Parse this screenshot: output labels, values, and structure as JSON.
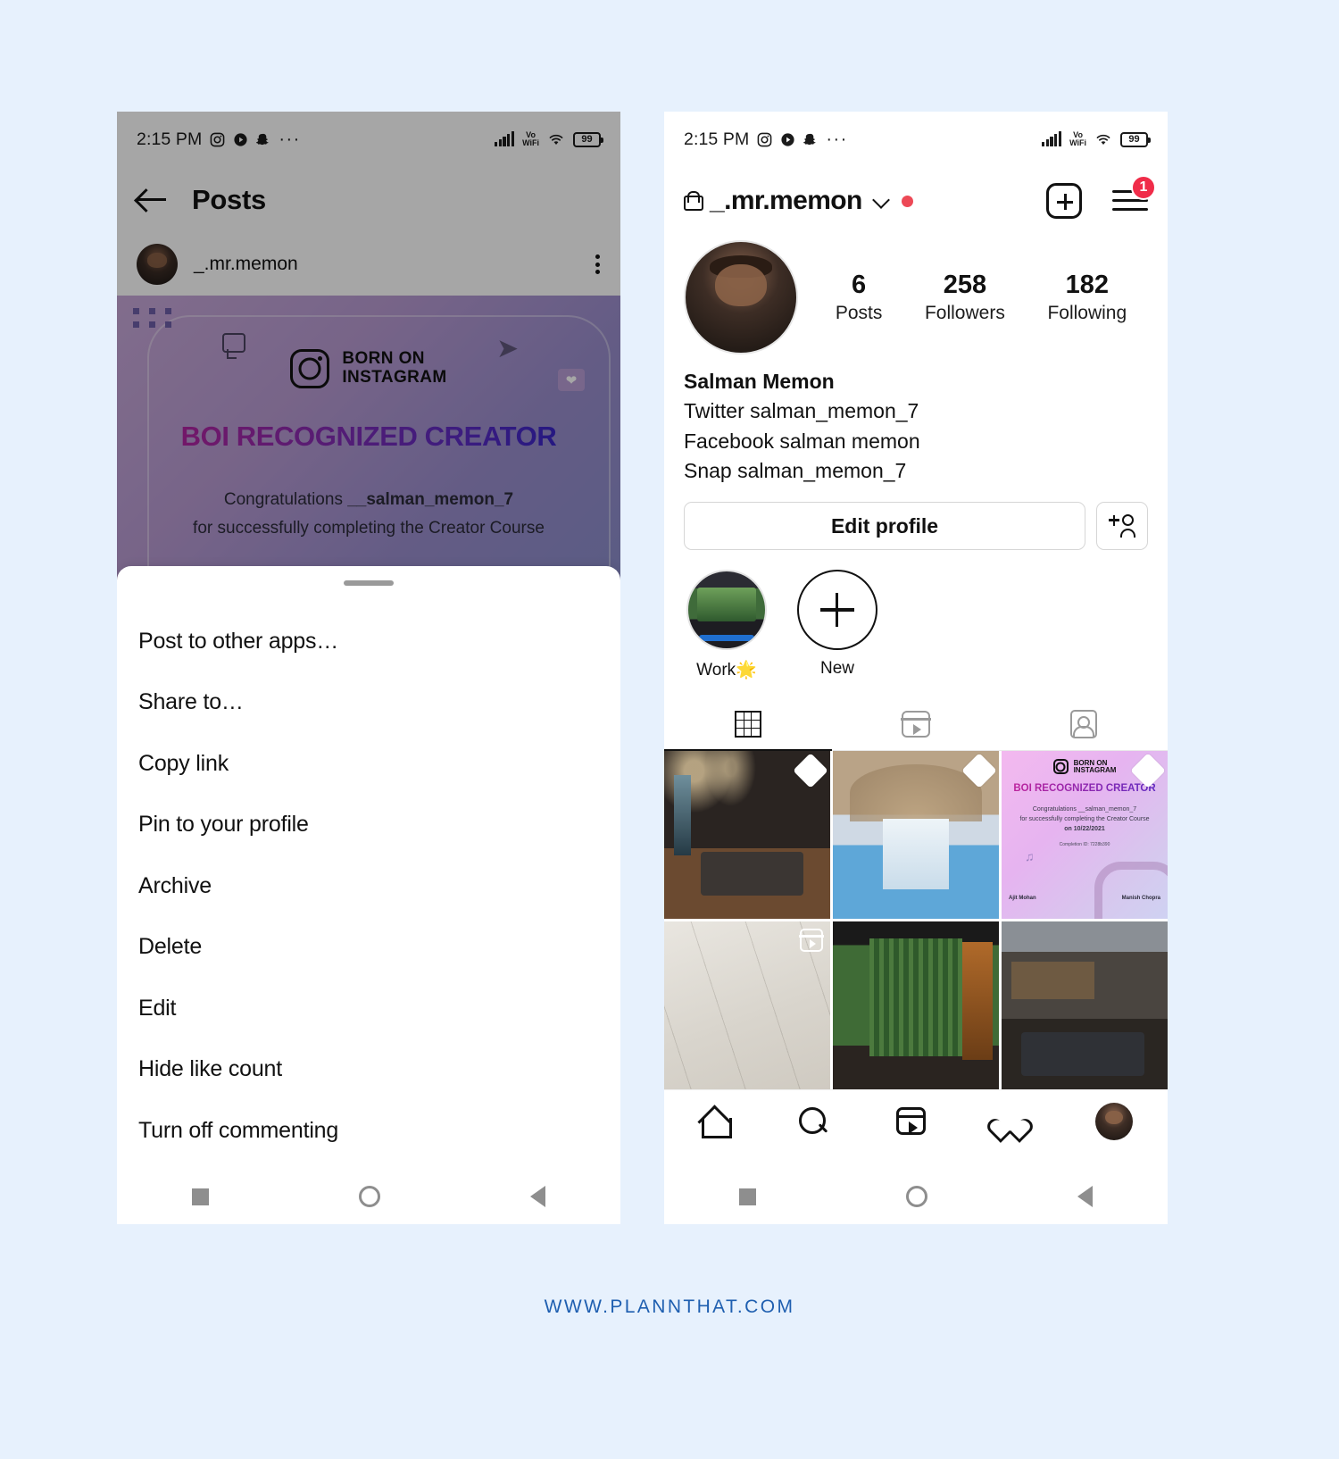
{
  "page": {
    "background_color": "#e7f1fd",
    "footer_text": "WWW.PLANNTHAT.COM",
    "footer_color": "#1f5fb0"
  },
  "status_bar": {
    "time": "2:15 PM",
    "icons": [
      "instagram-icon",
      "play-icon",
      "snapchat-icon",
      "overflow-dots-icon"
    ],
    "overflow_dots": "···",
    "signal": "signal-bars-icon",
    "volte_top": "Vo",
    "volte_bottom": "WiFi",
    "wifi": "wifi-icon",
    "battery_level": "99"
  },
  "left_phone": {
    "app_bar": {
      "back_label": "back-arrow",
      "title": "Posts"
    },
    "post_header": {
      "username": "_.mr.memon",
      "menu": "kebab-menu"
    },
    "post_image": {
      "badge_brand_line1": "BORN ON",
      "badge_brand_line2": "INSTAGRAM",
      "headline": "BOI RECOGNIZED CREATOR",
      "congrats_prefix": "Congratulations ",
      "congrats_handle": "__salman_memon_7",
      "subline": "for successfully completing the Creator Course"
    },
    "bottom_sheet": {
      "items": [
        "Post to other apps…",
        "Share to…",
        "Copy link",
        "Pin to your profile",
        "Archive",
        "Delete",
        "Edit",
        "Hide like count",
        "Turn off commenting"
      ]
    }
  },
  "right_phone": {
    "app_bar": {
      "lock_icon": "lock-icon",
      "username": "_.mr.memon",
      "chevron": "chevron-down-icon",
      "status_dot_color": "#ed4956",
      "create_icon": "plus-box-icon",
      "menu_icon": "hamburger-icon",
      "menu_badge": "1",
      "badge_color": "#f02c49"
    },
    "stats": [
      {
        "value": "6",
        "label": "Posts"
      },
      {
        "value": "258",
        "label": "Followers"
      },
      {
        "value": "182",
        "label": "Following"
      }
    ],
    "bio": {
      "name": "Salman Memon",
      "lines": [
        "Twitter salman_memon_7",
        "Facebook salman memon",
        "Snap salman_memon_7"
      ]
    },
    "actions": {
      "edit_profile": "Edit profile",
      "add_person_icon": "add-person-icon"
    },
    "highlights": [
      {
        "label": "Work🌟",
        "type": "cover"
      },
      {
        "label": "New",
        "type": "new"
      }
    ],
    "tabs": [
      {
        "icon": "grid-icon",
        "active": true
      },
      {
        "icon": "reels-icon",
        "active": false
      },
      {
        "icon": "tagged-icon",
        "active": false
      }
    ],
    "grid_posts": [
      {
        "name": "dark-bedroom-post",
        "corner": "pin"
      },
      {
        "name": "arched-pool-post",
        "corner": "pin"
      },
      {
        "name": "boi-certificate-post",
        "corner": "pin"
      },
      {
        "name": "concrete-floor-post",
        "corner": "reels"
      },
      {
        "name": "forest-kitchen-post",
        "corner": "none"
      },
      {
        "name": "loft-lounge-post",
        "corner": "none"
      }
    ],
    "certificate_tile": {
      "brand_line1": "BORN ON",
      "brand_line2": "INSTAGRAM",
      "title": "BOI RECOGNIZED CREATOR",
      "line1": "Congratulations  __salman_memon_7",
      "line2": "for successfully completing the Creator Course",
      "line3": "on 10/22/2021",
      "completion_id": "Completion ID: 7228b390",
      "signer_1": "Ajit Mohan",
      "signer_2": "Manish Chopra"
    },
    "bottom_nav": [
      "home-icon",
      "search-icon",
      "reels-icon",
      "heart-icon",
      "profile-avatar"
    ]
  },
  "android_nav": [
    "square-icon",
    "circle-icon",
    "triangle-icon"
  ]
}
